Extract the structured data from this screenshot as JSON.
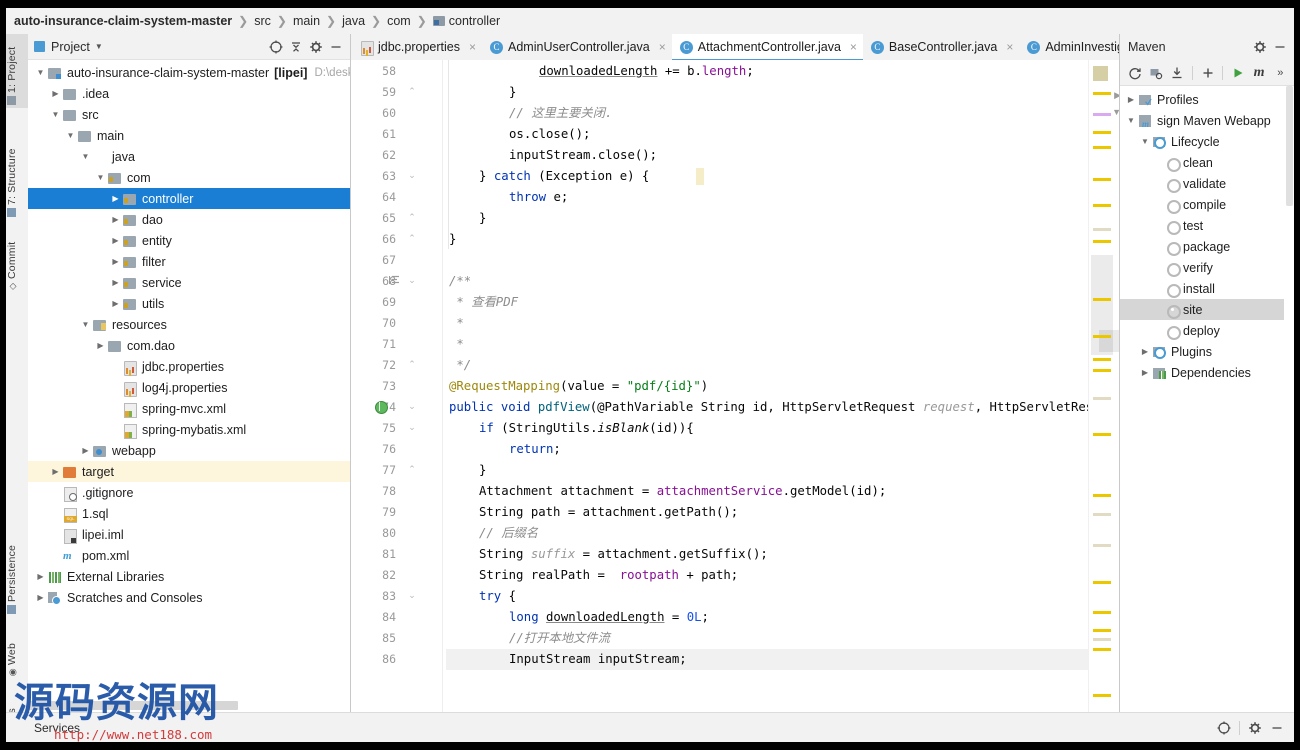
{
  "window": {
    "breadcrumb": [
      {
        "label": "auto-insurance-claim-system-master",
        "bold": true
      },
      {
        "label": "src",
        "bold": false
      },
      {
        "label": "main",
        "bold": false
      },
      {
        "label": "java",
        "bold": false
      },
      {
        "label": "com",
        "bold": false
      },
      {
        "label": "controller",
        "bold": false,
        "icon": "folder-icon"
      }
    ]
  },
  "left_strip": {
    "tabs": [
      {
        "label": "1: Project",
        "active": true,
        "icon": "project-icon"
      },
      {
        "label": "7: Structure",
        "active": false,
        "icon": "structure-icon"
      },
      {
        "label": "Commit",
        "active": false,
        "icon": "commit-icon"
      },
      {
        "label": "Persistence",
        "active": false,
        "icon": "persistence-icon"
      },
      {
        "label": "Web",
        "active": false,
        "icon": "web-icon"
      },
      {
        "label": "Favorites",
        "active": false,
        "icon": "favorites-icon"
      }
    ]
  },
  "project_panel": {
    "title": "Project",
    "caret": "▼",
    "toolbar": [
      {
        "name": "locate-icon",
        "glyph": "⊕"
      },
      {
        "name": "collapse-all-icon",
        "glyph": "≡"
      },
      {
        "name": "gear-icon",
        "glyph": "⚙"
      },
      {
        "name": "hide-icon",
        "glyph": "—"
      }
    ],
    "tree": [
      {
        "indent": 0,
        "arrow": "▼",
        "icon": "module-icon",
        "label": "auto-insurance-claim-system-master",
        "suffix": "[lipei]",
        "path": "D:\\desk\\auto-i",
        "state": "normal"
      },
      {
        "indent": 1,
        "arrow": "▶",
        "icon": "folder-icon",
        "label": ".idea",
        "state": "normal"
      },
      {
        "indent": 1,
        "arrow": "▼",
        "icon": "folder-icon",
        "label": "src",
        "state": "normal"
      },
      {
        "indent": 2,
        "arrow": "▼",
        "icon": "folder-icon",
        "label": "main",
        "state": "normal"
      },
      {
        "indent": 3,
        "arrow": "▼",
        "icon": "folder-java-icon",
        "label": "java",
        "state": "normal"
      },
      {
        "indent": 4,
        "arrow": "▼",
        "icon": "package-icon",
        "label": "com",
        "state": "normal"
      },
      {
        "indent": 5,
        "arrow": "▶",
        "icon": "package-icon",
        "label": "controller",
        "state": "selected"
      },
      {
        "indent": 5,
        "arrow": "▶",
        "icon": "package-icon",
        "label": "dao",
        "state": "normal"
      },
      {
        "indent": 5,
        "arrow": "▶",
        "icon": "package-icon",
        "label": "entity",
        "state": "normal"
      },
      {
        "indent": 5,
        "arrow": "▶",
        "icon": "package-icon",
        "label": "filter",
        "state": "normal"
      },
      {
        "indent": 5,
        "arrow": "▶",
        "icon": "package-icon",
        "label": "service",
        "state": "normal"
      },
      {
        "indent": 5,
        "arrow": "▶",
        "icon": "package-icon",
        "label": "utils",
        "state": "normal"
      },
      {
        "indent": 3,
        "arrow": "▼",
        "icon": "folder-resources-icon",
        "label": "resources",
        "state": "normal"
      },
      {
        "indent": 4,
        "arrow": "▶",
        "icon": "folder-icon",
        "label": "com.dao",
        "state": "normal"
      },
      {
        "indent": 5,
        "arrow": "",
        "icon": "properties-file-icon",
        "label": "jdbc.properties",
        "state": "normal"
      },
      {
        "indent": 5,
        "arrow": "",
        "icon": "properties-file-icon",
        "label": "log4j.properties",
        "state": "normal"
      },
      {
        "indent": 5,
        "arrow": "",
        "icon": "xml-file-icon",
        "label": "spring-mvc.xml",
        "state": "normal"
      },
      {
        "indent": 5,
        "arrow": "",
        "icon": "xml-file-icon",
        "label": "spring-mybatis.xml",
        "state": "normal"
      },
      {
        "indent": 3,
        "arrow": "▶",
        "icon": "folder-web-icon",
        "label": "webapp",
        "state": "normal"
      },
      {
        "indent": 1,
        "arrow": "▶",
        "icon": "folder-target-icon",
        "label": "target",
        "state": "highlight"
      },
      {
        "indent": 1,
        "arrow": "",
        "icon": "gitignore-file-icon",
        "label": ".gitignore",
        "state": "normal"
      },
      {
        "indent": 1,
        "arrow": "",
        "icon": "sql-file-icon",
        "label": "1.sql",
        "state": "normal"
      },
      {
        "indent": 1,
        "arrow": "",
        "icon": "iml-file-icon",
        "label": "lipei.iml",
        "state": "normal"
      },
      {
        "indent": 1,
        "arrow": "",
        "icon": "maven-file-icon",
        "label": "pom.xml",
        "state": "normal"
      },
      {
        "indent": 0,
        "arrow": "▶",
        "icon": "libraries-icon",
        "label": "External Libraries",
        "state": "normal"
      },
      {
        "indent": 0,
        "arrow": "▶",
        "icon": "scratches-icon",
        "label": "Scratches and Consoles",
        "state": "normal"
      }
    ]
  },
  "editor": {
    "tabs": [
      {
        "label": "jdbc.properties",
        "icon": "properties-file-icon",
        "active": false,
        "close": "×"
      },
      {
        "label": "AdminUserController.java",
        "icon": "class-icon",
        "active": false,
        "close": "×"
      },
      {
        "label": "AttachmentController.java",
        "icon": "class-icon",
        "active": true,
        "close": "×"
      },
      {
        "label": "BaseController.java",
        "icon": "class-icon",
        "active": false,
        "close": "×"
      },
      {
        "label": "AdminInvestigationControl",
        "icon": "class-icon",
        "active": false,
        "close": ""
      }
    ],
    "tabs_overflow": "⌄",
    "first_line": 58,
    "current_line": 86,
    "lines": [
      {
        "n": 58,
        "indent": 3,
        "fold": "",
        "text": "downloadedLength += b.length;"
      },
      {
        "n": 59,
        "indent": 2,
        "fold": "⌃",
        "text": "}"
      },
      {
        "n": 60,
        "indent": 2,
        "fold": "",
        "text": "// 这里主要关闭."
      },
      {
        "n": 61,
        "indent": 2,
        "fold": "",
        "text": "os.close();"
      },
      {
        "n": 62,
        "indent": 2,
        "fold": "",
        "text": "inputStream.close();"
      },
      {
        "n": 63,
        "indent": 1,
        "fold": "⌄",
        "text": "} catch (Exception e) {"
      },
      {
        "n": 64,
        "indent": 2,
        "fold": "",
        "text": "throw e;"
      },
      {
        "n": 65,
        "indent": 1,
        "fold": "⌃",
        "text": "}"
      },
      {
        "n": 66,
        "indent": 0,
        "fold": "⌃",
        "text": "}"
      },
      {
        "n": 67,
        "indent": 0,
        "fold": "",
        "text": ""
      },
      {
        "n": 68,
        "indent": 0,
        "fold": "⌄",
        "text": "/**"
      },
      {
        "n": 69,
        "indent": 0,
        "fold": "",
        "text": " * 查看PDF"
      },
      {
        "n": 70,
        "indent": 0,
        "fold": "",
        "text": " *"
      },
      {
        "n": 71,
        "indent": 0,
        "fold": "",
        "text": " *"
      },
      {
        "n": 72,
        "indent": 0,
        "fold": "⌃",
        "text": " */"
      },
      {
        "n": 73,
        "indent": 0,
        "fold": "",
        "text": "@RequestMapping(value = \"pdf/{id}\")"
      },
      {
        "n": 74,
        "indent": 0,
        "fold": "⌄",
        "text": "public void pdfView(@PathVariable String id, HttpServletRequest request, HttpServletResponse response"
      },
      {
        "n": 75,
        "indent": 1,
        "fold": "⌄",
        "text": "if (StringUtils.isBlank(id)){"
      },
      {
        "n": 76,
        "indent": 2,
        "fold": "",
        "text": "return;"
      },
      {
        "n": 77,
        "indent": 1,
        "fold": "⌃",
        "text": "}"
      },
      {
        "n": 78,
        "indent": 1,
        "fold": "",
        "text": "Attachment attachment = attachmentService.getModel(id);"
      },
      {
        "n": 79,
        "indent": 1,
        "fold": "",
        "text": "String path = attachment.getPath();"
      },
      {
        "n": 80,
        "indent": 1,
        "fold": "",
        "text": "// 后缀名"
      },
      {
        "n": 81,
        "indent": 1,
        "fold": "",
        "text": "String suffix = attachment.getSuffix();"
      },
      {
        "n": 82,
        "indent": 1,
        "fold": "",
        "text": "String realPath =  rootpath + path;"
      },
      {
        "n": 83,
        "indent": 1,
        "fold": "⌄",
        "text": "try {"
      },
      {
        "n": 84,
        "indent": 2,
        "fold": "",
        "text": "long downloadedLength = 0L;"
      },
      {
        "n": 85,
        "indent": 2,
        "fold": "",
        "text": "//打开本地文件流"
      },
      {
        "n": 86,
        "indent": 2,
        "fold": "",
        "text": "InputStream inputStream;"
      }
    ],
    "run_gutter_line": 74,
    "doc_gutter_line": 68
  },
  "maven_panel": {
    "title": "Maven",
    "header_icons": [
      {
        "name": "gear-icon",
        "glyph": "⚙"
      },
      {
        "name": "hide-icon",
        "glyph": "—"
      }
    ],
    "toolbar": [
      {
        "name": "reload-icon",
        "glyph": "⟳"
      },
      {
        "name": "add-maven-project-icon",
        "glyph": "◧"
      },
      {
        "name": "download-sources-icon",
        "glyph": "⤓"
      },
      {
        "name": "add-icon",
        "glyph": "+"
      },
      {
        "name": "run-icon",
        "glyph": "▶"
      },
      {
        "name": "maven-goal-icon",
        "glyph": "m"
      },
      {
        "name": "more-icon",
        "glyph": "»"
      }
    ],
    "tree": [
      {
        "indent": 0,
        "arrow": "▶",
        "icon": "profiles-icon",
        "label": "Profiles",
        "state": "normal"
      },
      {
        "indent": 0,
        "arrow": "▼",
        "icon": "maven-project-icon",
        "label": "sign Maven Webapp",
        "state": "normal"
      },
      {
        "indent": 1,
        "arrow": "▼",
        "icon": "lifecycle-icon",
        "label": "Lifecycle",
        "state": "normal"
      },
      {
        "indent": 2,
        "arrow": "",
        "icon": "goal-icon",
        "label": "clean",
        "state": "normal"
      },
      {
        "indent": 2,
        "arrow": "",
        "icon": "goal-icon",
        "label": "validate",
        "state": "normal"
      },
      {
        "indent": 2,
        "arrow": "",
        "icon": "goal-icon",
        "label": "compile",
        "state": "normal"
      },
      {
        "indent": 2,
        "arrow": "",
        "icon": "goal-icon",
        "label": "test",
        "state": "normal"
      },
      {
        "indent": 2,
        "arrow": "",
        "icon": "goal-icon",
        "label": "package",
        "state": "normal"
      },
      {
        "indent": 2,
        "arrow": "",
        "icon": "goal-icon",
        "label": "verify",
        "state": "normal"
      },
      {
        "indent": 2,
        "arrow": "",
        "icon": "goal-icon",
        "label": "install",
        "state": "normal"
      },
      {
        "indent": 2,
        "arrow": "",
        "icon": "goal-icon",
        "label": "site",
        "state": "selected"
      },
      {
        "indent": 2,
        "arrow": "",
        "icon": "goal-icon",
        "label": "deploy",
        "state": "normal"
      },
      {
        "indent": 1,
        "arrow": "▶",
        "icon": "plugins-icon",
        "label": "Plugins",
        "state": "normal"
      },
      {
        "indent": 1,
        "arrow": "▶",
        "icon": "dependencies-icon",
        "label": "Dependencies",
        "state": "normal"
      }
    ]
  },
  "status_bar": {
    "services_label": "Services",
    "icons": [
      {
        "name": "locate-icon",
        "glyph": "⊕"
      },
      {
        "name": "gear-icon",
        "glyph": "⚙"
      },
      {
        "name": "hide-icon",
        "glyph": "—"
      }
    ]
  },
  "watermark": {
    "text": "源码资源网",
    "url": "http://www.net188.com"
  },
  "colors": {
    "selection_blue": "#1a7fd4",
    "tab_underline": "#4a9ad4",
    "warn_stripe": "#ebc700",
    "target_highlight": "#fdf6dd",
    "keyword": "#0033b3",
    "string": "#067d17",
    "annotation": "#9e880d",
    "comment": "#8c8c8c",
    "field": "#871094"
  }
}
